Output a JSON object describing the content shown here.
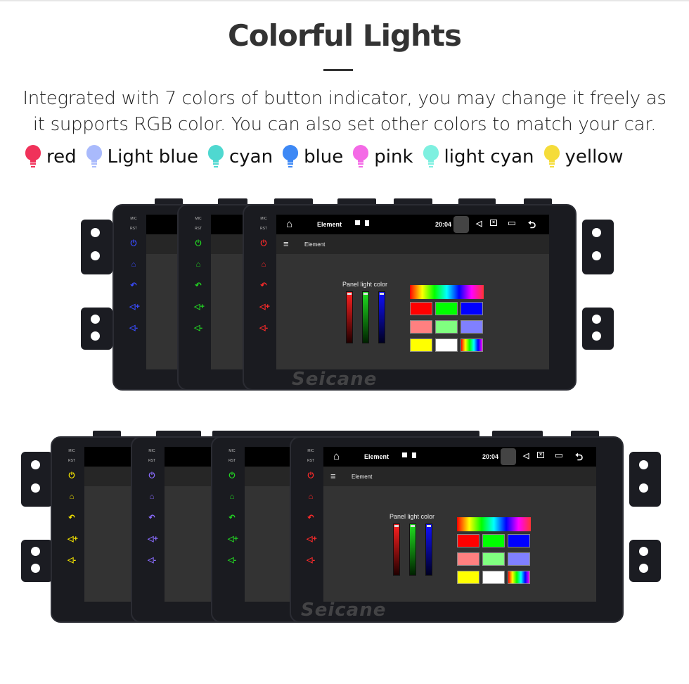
{
  "title": "Colorful Lights",
  "description": [
    "Integrated with 7 colors of button indicator, you may change it freely as",
    "it supports RGB color. You can also set other colors to match your car."
  ],
  "legend": [
    {
      "label": "red",
      "color": "#f0325a"
    },
    {
      "label": "Light blue",
      "color": "#a9bafc"
    },
    {
      "label": "cyan",
      "color": "#4fd8d0"
    },
    {
      "label": "blue",
      "color": "#3d88f5"
    },
    {
      "label": "pink",
      "color": "#f46ae6"
    },
    {
      "label": "light cyan",
      "color": "#7ef0e0"
    },
    {
      "label": "yellow",
      "color": "#f5dc3a"
    }
  ],
  "device": {
    "side_labels": [
      "MIC",
      "RST"
    ],
    "side_buttons": [
      "power-icon",
      "home-icon",
      "back-icon",
      "volume-up-icon",
      "volume-down-icon"
    ],
    "status_title": "Element",
    "time": "20:04",
    "app_title": "Element",
    "panel_label": "Panel light color",
    "watermark": "Seicane",
    "swatches": [
      "#ff0000",
      "#00ff00",
      "#0000ff",
      "#ff8080",
      "#80ff80",
      "#8080ff",
      "#ffff00",
      "#ffffff",
      "rainbow"
    ]
  },
  "top_stack_button_colors": [
    "#3a4cff",
    "#22d422",
    "#ff2a2a"
  ],
  "bottom_stack_button_colors": [
    "#f2e200",
    "#8a6cff",
    "#22d422",
    "#ff2a2a"
  ]
}
